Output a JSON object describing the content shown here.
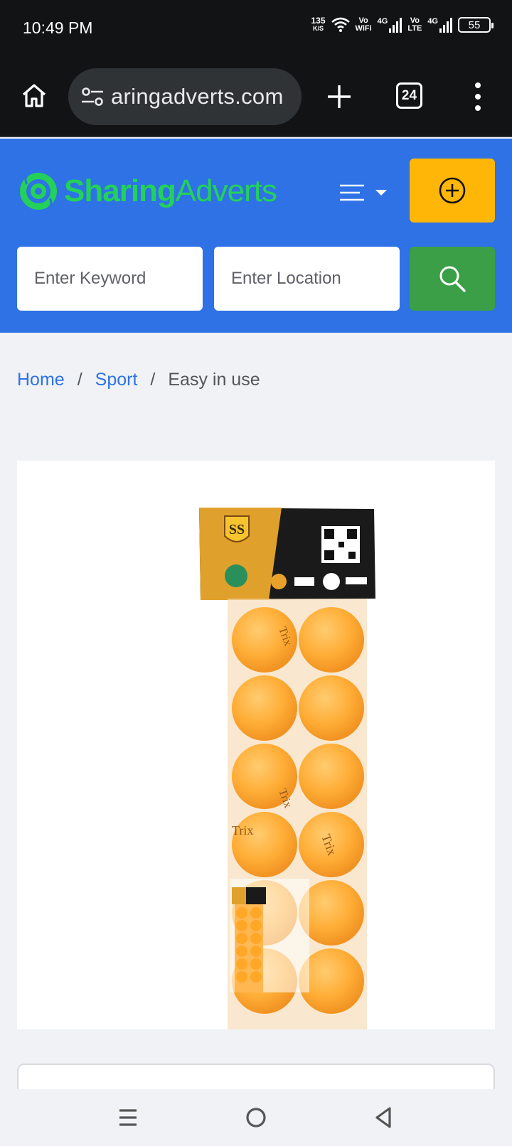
{
  "status_bar": {
    "time": "10:49 PM",
    "net_speed_value": "135",
    "net_speed_unit": "K/S",
    "vowifi_top": "Vo",
    "vowifi_bottom": "WiFi",
    "sim1_type": "4G",
    "volte_top": "Vo",
    "volte_bottom": "LTE",
    "sim2_type": "4G",
    "battery": "55"
  },
  "browser": {
    "url_text": "aringadverts.com",
    "tab_count": "24",
    "icons": [
      "home-icon",
      "site-settings-icon",
      "new-tab-plus-icon",
      "tab-switcher-icon",
      "overflow-menu-icon"
    ]
  },
  "header": {
    "brand_part1": "Sharing",
    "brand_part2": "Adverts",
    "keyword_placeholder": "Enter Keyword",
    "location_placeholder": "Enter Location",
    "colors": {
      "header_bg": "#2e72e6",
      "brand_green": "#23d15a",
      "post_button": "#ffb607",
      "search_button": "#3a9f46"
    }
  },
  "breadcrumb": {
    "items": [
      {
        "label": "Home",
        "link": true
      },
      {
        "label": "Sport",
        "link": true
      },
      {
        "label": "Easy in use",
        "link": false
      }
    ],
    "separator": "/"
  },
  "product": {
    "image_description_icon": "product-photo",
    "package_label": "SS",
    "ball_brand": "Trix"
  },
  "android_nav": {
    "icons": [
      "recents-icon",
      "home-circle-icon",
      "back-triangle-icon"
    ]
  }
}
